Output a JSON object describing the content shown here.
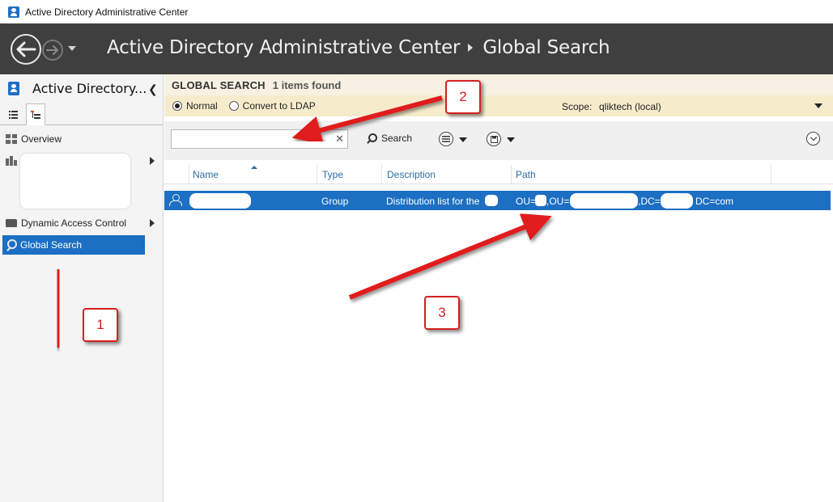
{
  "window": {
    "title": "Active Directory Administrative Center"
  },
  "header": {
    "breadcrumbs": [
      "Active Directory Administrative Center",
      "Global Search"
    ]
  },
  "sidebar": {
    "title": "Active Directory...",
    "items": [
      {
        "label": "Overview"
      },
      {
        "label": "Dynamic Access Control"
      },
      {
        "label": "Global Search"
      }
    ]
  },
  "search": {
    "title": "GLOBAL SEARCH",
    "count": "1 items found",
    "mode_normal": "Normal",
    "mode_ldap": "Convert to LDAP",
    "scope_label": "Scope:",
    "scope_value": "qliktech (local)",
    "input_value": "",
    "search_label": "Search"
  },
  "table": {
    "columns": [
      "Name",
      "Type",
      "Description",
      "Path"
    ],
    "rows": [
      {
        "name": "",
        "type": "Group",
        "description": "Distribution list for the",
        "path_parts": [
          "OU=",
          ",OU=",
          ",DC=",
          "DC=com"
        ]
      }
    ]
  },
  "annotations": [
    "1",
    "2",
    "3"
  ],
  "colors": {
    "selection": "#1c6fc2",
    "header_band": "#3f3f3f",
    "annotation": "#d42020"
  }
}
